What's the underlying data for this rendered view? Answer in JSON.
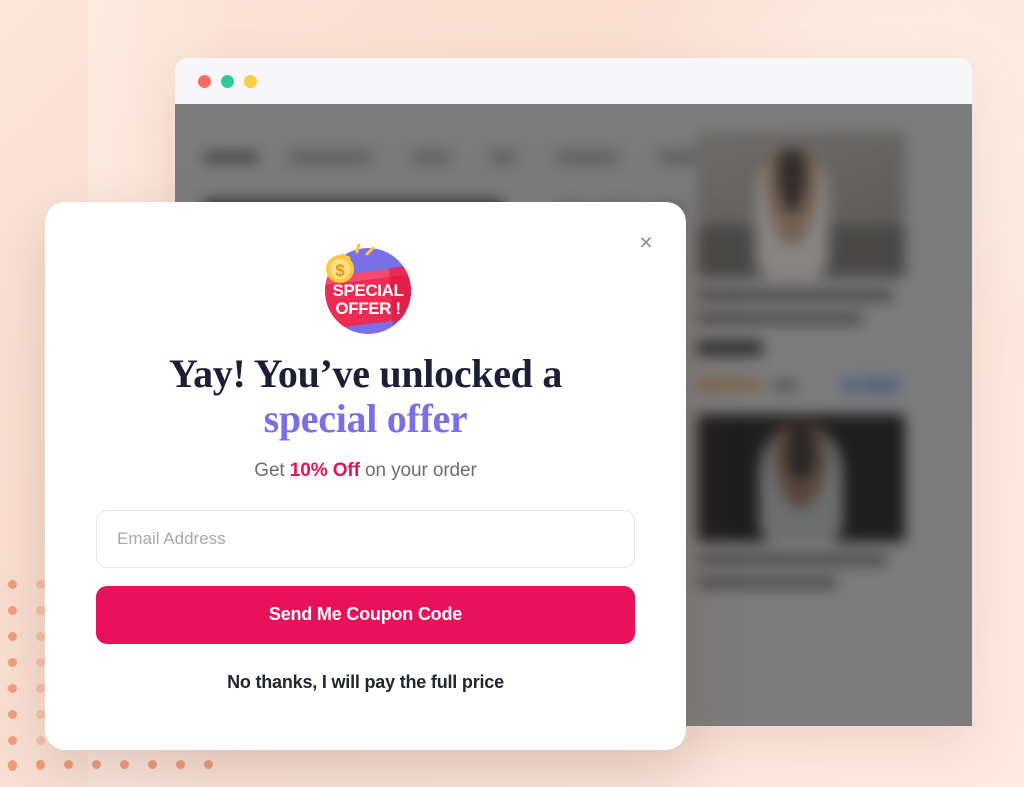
{
  "background": {
    "gradient_from": "#fbe4d8",
    "gradient_to": "#fde9e0",
    "dot_color": "#ef9f7b"
  },
  "browser": {
    "traffic_lights": [
      {
        "name": "close",
        "color": "#f96a63"
      },
      {
        "name": "minimize",
        "color": "#2ecb97"
      },
      {
        "name": "maximize",
        "color": "#f7ce45"
      }
    ],
    "content_state": "blurred-dimmed-ecommerce-page",
    "chips_count": 7,
    "product_cards": 2
  },
  "modal": {
    "close_label": "×",
    "badge": {
      "icon": "special-offer-badge-icon",
      "ribbon_line1": "SPECIAL",
      "ribbon_line2": "OFFER !",
      "coin_symbol": "$",
      "circle_color": "#7b6fe8",
      "ribbon_color": "#ef2b53",
      "coin_color": "#ffc93c"
    },
    "headline_line1": "Yay! You’ve unlocked a",
    "headline_accent": "special offer",
    "headline_color": "#1d1f36",
    "accent_color": "#7b6fe8",
    "subline_prefix": "Get ",
    "subline_discount": "10% Off",
    "subline_suffix": " on your order",
    "discount_color": "#e8115b",
    "email": {
      "placeholder": "Email Address",
      "value": ""
    },
    "cta_label": "Send Me Coupon Code",
    "cta_color": "#e8115b",
    "decline_label": "No thanks, I will pay the full price"
  }
}
